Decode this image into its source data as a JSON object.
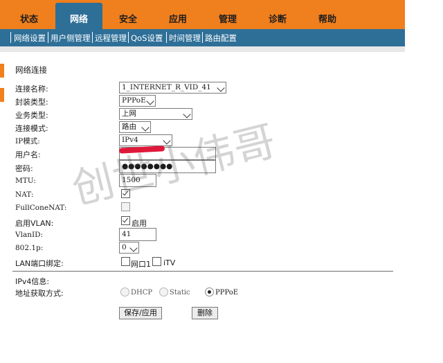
{
  "top_tabs": [
    "状态",
    "网络",
    "安全",
    "应用",
    "管理",
    "诊断",
    "帮助"
  ],
  "active_tab": "网络",
  "sub_nav": [
    "网络设置",
    "用户侧管理",
    "远程管理",
    "QoS设置",
    "时间管理",
    "路由配置"
  ],
  "section_title": "网络连接",
  "form": {
    "conn_name_label": "连接名称:",
    "conn_name_value": "1_INTERNET_R_VID_41",
    "encap_label": "封装类型:",
    "encap_value": "PPPoE",
    "service_label": "业务类型:",
    "service_value": "上网",
    "mode_label": "连接模式:",
    "mode_value": "路由",
    "ip_mode_label": "IP模式:",
    "ip_mode_value": "IPv4",
    "username_label": "用户名:",
    "username_value": "",
    "password_label": "密码:",
    "password_value": "●●●●●●●●",
    "mtu_label": "MTU:",
    "mtu_value": "1500",
    "nat_label": "NAT:",
    "nat_checked": true,
    "fullcone_label": "FullConeNAT:",
    "fullcone_checked": false,
    "vlan_label": "启用VLAN:",
    "vlan_checked": true,
    "vlan_enable_text": "启用",
    "vlanid_label": "VlanID:",
    "vlanid_value": "41",
    "dot1p_label": "802.1p:",
    "dot1p_value": "0",
    "lan_bind_label": "LAN端口绑定:",
    "lan_port1": "网口1",
    "lan_itv": "iTV"
  },
  "ipv4": {
    "title": "IPv4信息:",
    "addr_label": "地址获取方式:",
    "options": [
      "DHCP",
      "Static",
      "PPPoE"
    ],
    "selected": "PPPoE"
  },
  "buttons": {
    "save": "保存/应用",
    "delete": "删除"
  },
  "watermark": "创世小伟哥",
  "colors": {
    "orange": "#f07f1d",
    "blue": "#2e6f98"
  }
}
